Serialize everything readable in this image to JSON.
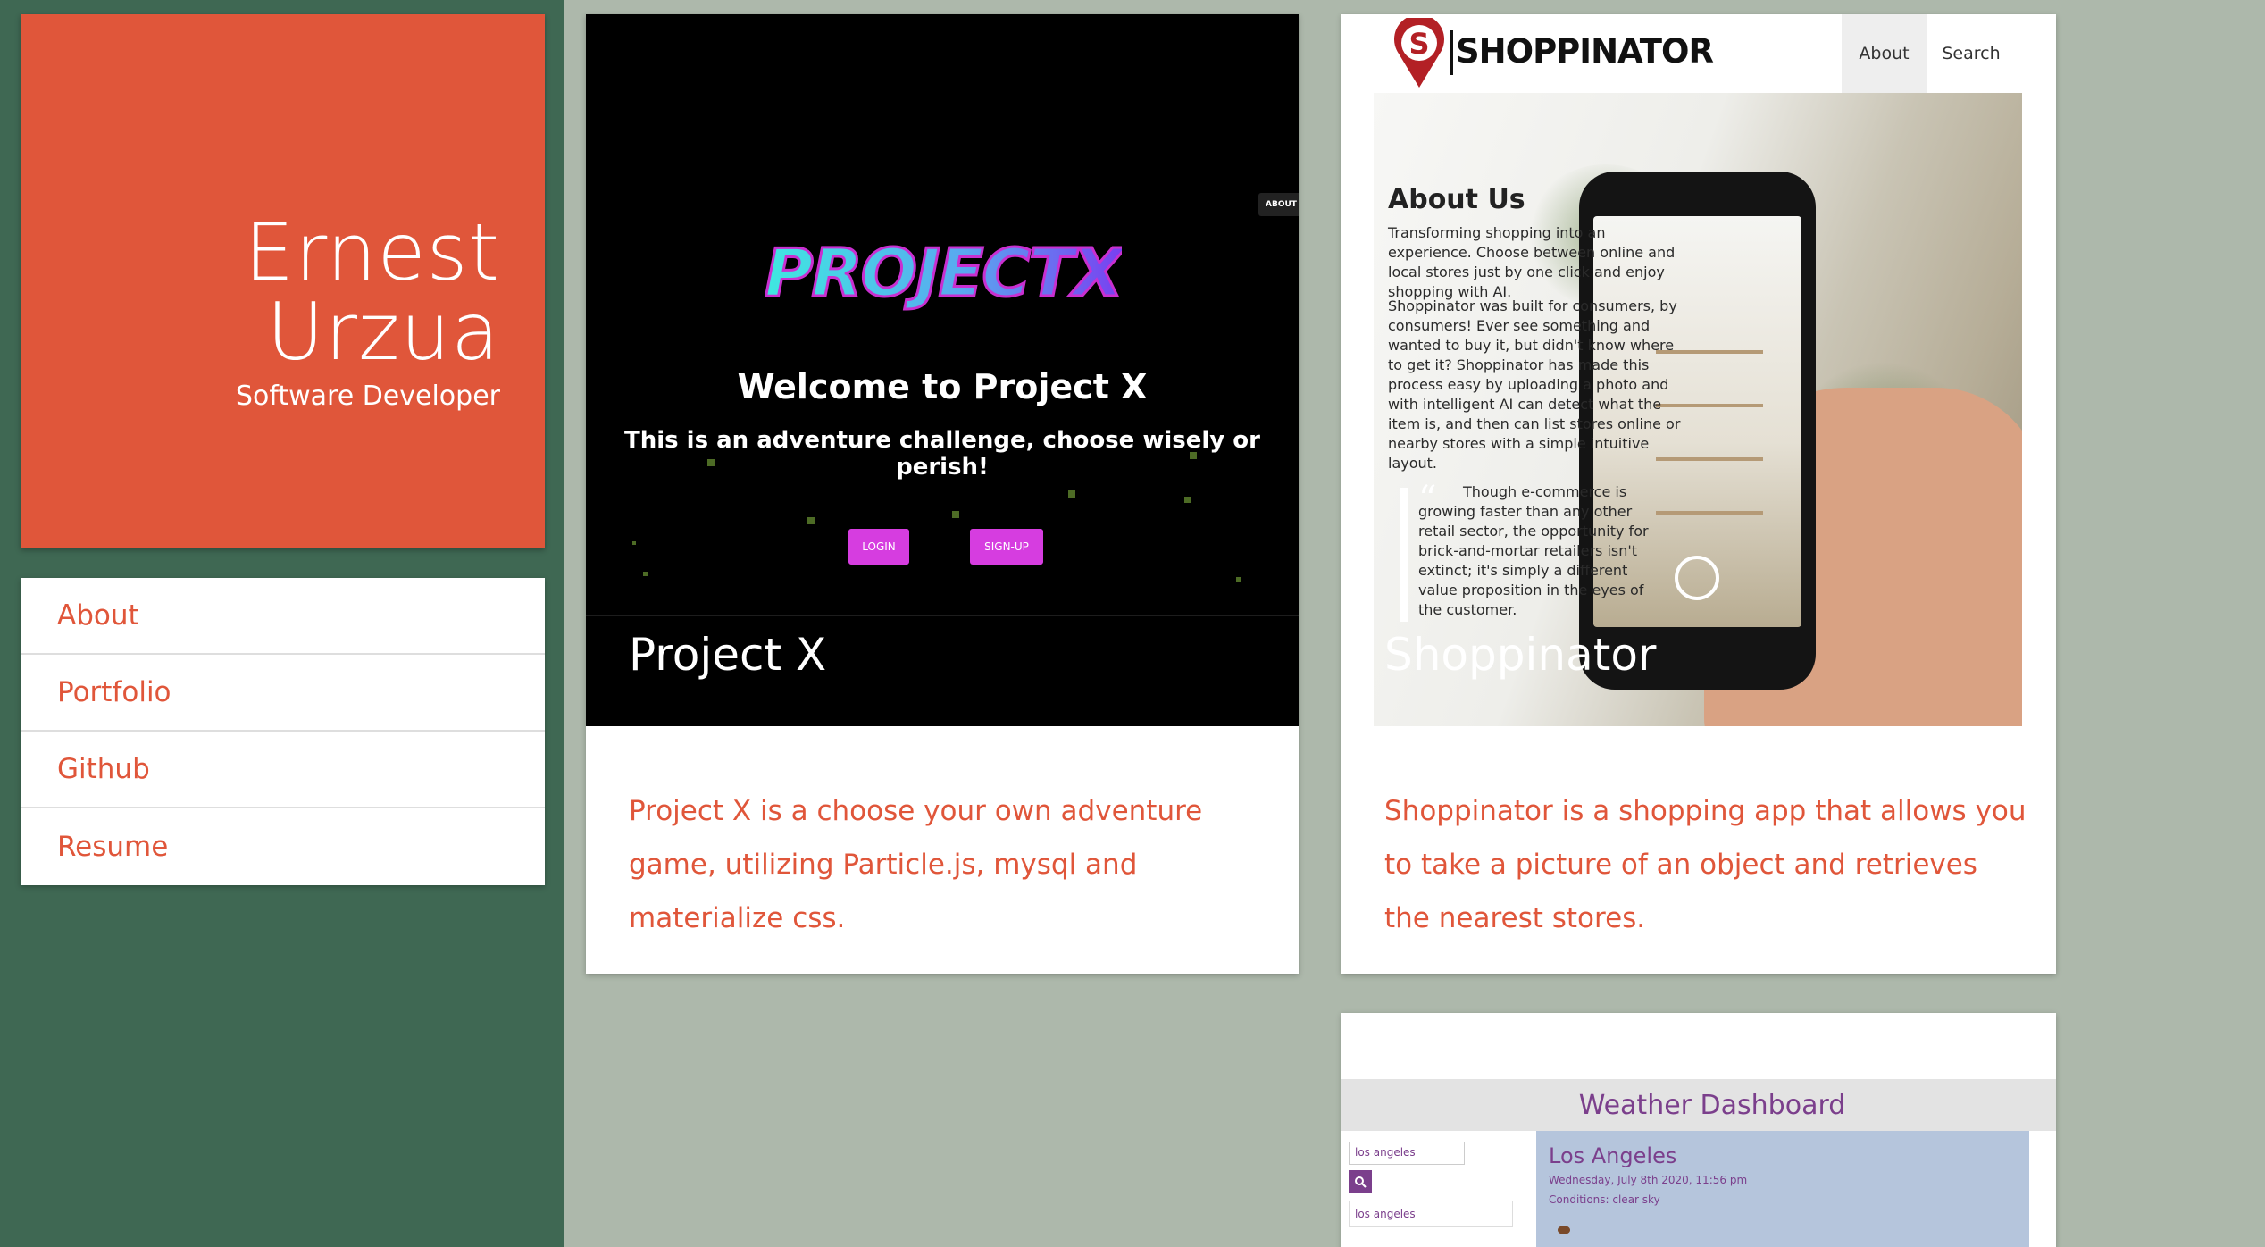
{
  "profile": {
    "first_name": "Ernest",
    "last_name": "Urzua",
    "role": "Software Developer"
  },
  "nav": {
    "items": [
      {
        "label": "About"
      },
      {
        "label": "Portfolio"
      },
      {
        "label": "Github"
      },
      {
        "label": "Resume"
      }
    ]
  },
  "projects": [
    {
      "title": "Project X",
      "description": "Project X is a choose your own adventure game, utilizing Particle.js, mysql and materialize css.",
      "screenshot": {
        "logo": "PROJECTX",
        "welcome": "Welcome to Project X",
        "subtitle": "This is an adventure challenge, choose wisely or perish!",
        "login_label": "LOGIN",
        "signup_label": "SIGN-UP",
        "about_tab": "ABOUT US"
      }
    },
    {
      "title": "Shoppinator",
      "description": "Shoppinator is a shopping app that allows you to take a picture of an object and retrieves the nearest stores.",
      "screenshot": {
        "logo_letter": "S",
        "logo_text": "SHOPPINATOR",
        "nav_about": "About",
        "nav_search": "Search",
        "about_title": "About Us",
        "para1": "Transforming shopping into an experience. Choose between online and local stores just by one click and enjoy shopping with AI.",
        "para2": "Shoppinator was built for consumers, by consumers! Ever see something and wanted to buy it, but didn't know where to get it? Shoppinator has made this process easy by uploading a photo and with intelligent AI can detect what the item is, and then can list stores online or nearby stores with a simple intuitive layout.",
        "quote": "Though e-commerce is growing faster than any other retail sector, the opportunity for brick-and-mortar retailers isn't extinct; it's simply a different value proposition in the eyes of the customer."
      }
    },
    {
      "title": "Weather Dashboard",
      "screenshot": {
        "search_value": "los angeles",
        "history_item": "los angeles",
        "city": "Los Angeles",
        "date": "Wednesday, July 8th 2020, 11:56 pm",
        "conditions": "Conditions: clear sky"
      }
    }
  ],
  "colors": {
    "accent": "#e0563a",
    "sidebar": "#3f6853",
    "background": "#adb8ab",
    "weather_header": "#7b3f8c"
  }
}
